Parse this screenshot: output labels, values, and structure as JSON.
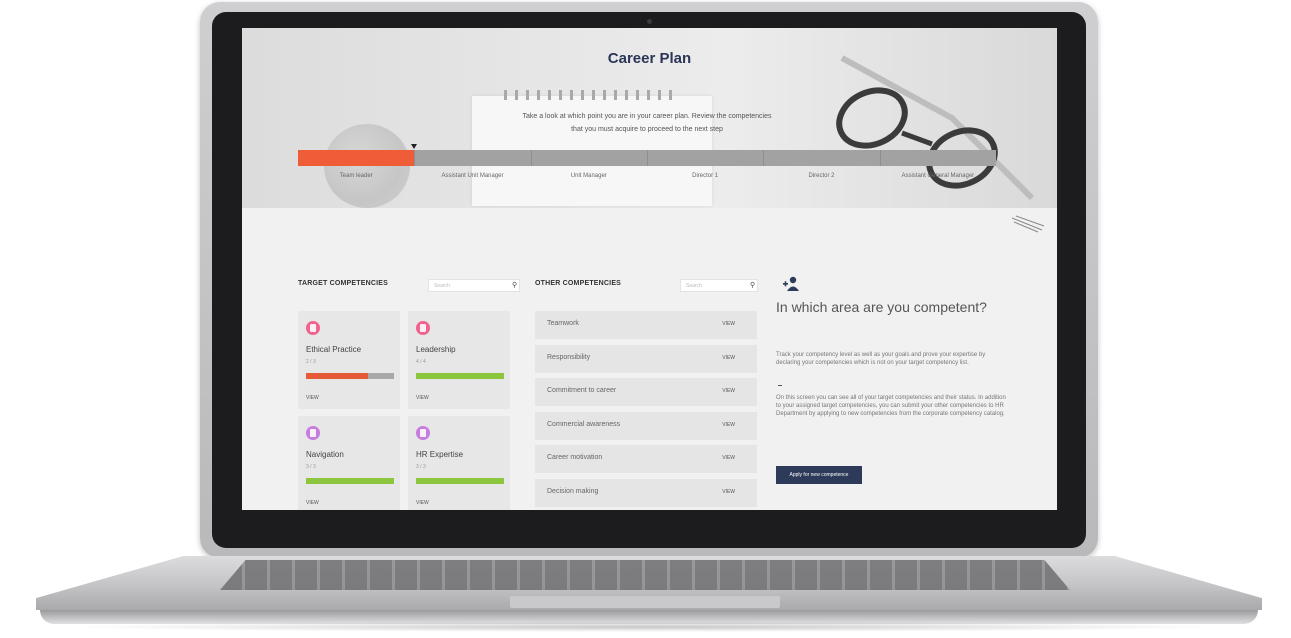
{
  "page": {
    "title": "Career Plan",
    "intro_line1": "Take a look at which point you are in your career plan. Review the competencies",
    "intro_line2": "that you must acquire to proceed to the next step"
  },
  "career_ladder": {
    "steps": [
      "Team leader",
      "Assistant Unit Manager",
      "Unit Manager",
      "Director 1",
      "Director 2",
      "Assistant General Manager"
    ],
    "current_step": 1,
    "current_color": "#ee5c38"
  },
  "target_competencies": {
    "title": "TARGET COMPETENCIES",
    "search_placeholder": "Search",
    "items": [
      {
        "name": "Ethical Practice",
        "count": "2 / 3",
        "progress": 0.7,
        "bar_color": "#e65a38",
        "icon_color": "#f2628e",
        "view": "VIEW"
      },
      {
        "name": "Leadership",
        "count": "4 / 4",
        "progress": 1.0,
        "bar_color": "#8cc63f",
        "icon_color": "#f2628e",
        "view": "VIEW"
      },
      {
        "name": "Navigation",
        "count": "3 / 3",
        "progress": 1.0,
        "bar_color": "#8cc63f",
        "icon_color": "#c77ce0",
        "view": "VIEW"
      },
      {
        "name": "HR Expertise",
        "count": "3 / 3",
        "progress": 1.0,
        "bar_color": "#8cc63f",
        "icon_color": "#c77ce0",
        "view": "VIEW"
      }
    ]
  },
  "other_competencies": {
    "title": "OTHER COMPETENCIES",
    "search_placeholder": "Search",
    "items": [
      {
        "name": "Teamwork",
        "view": "VIEW"
      },
      {
        "name": "Responsibility",
        "view": "VIEW"
      },
      {
        "name": "Commitment to career",
        "view": "VIEW"
      },
      {
        "name": "Commercial awareness",
        "view": "VIEW"
      },
      {
        "name": "Career motivation",
        "view": "VIEW"
      },
      {
        "name": "Decision making",
        "view": "VIEW"
      }
    ]
  },
  "info_panel": {
    "icon": "add-person-icon",
    "title": "In which area are you competent?",
    "text1": "Track your competency level  as well as your goals and prove your expertise by declaring your competencies which is not on your target competency list.",
    "text2": "On this screen you can see all of your target competencies and their status. In addition to your assigned target competencies, you can submit your other competencies to HR Department by applying to new competencies from the corporate competency catalog.",
    "apply_button": "Apply for  new competence"
  }
}
